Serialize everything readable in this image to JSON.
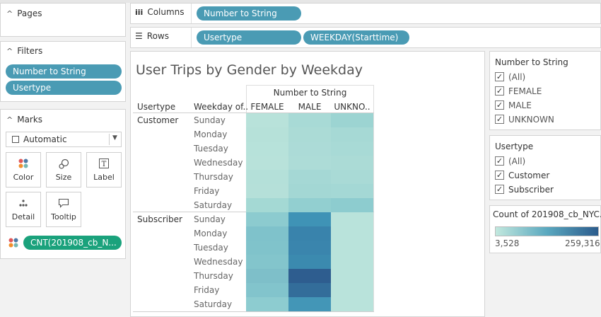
{
  "left": {
    "pages_title": "Pages",
    "filters_title": "Filters",
    "filters": [
      "Number to String",
      "Usertype"
    ],
    "marks_title": "Marks",
    "mark_type": "Automatic",
    "buttons": {
      "color": "Color",
      "size": "Size",
      "label": "Label",
      "detail": "Detail",
      "tooltip": "Tooltip"
    },
    "cnt_pill": "CNT(201908_cb_N..."
  },
  "shelves": {
    "columns_label": "Columns",
    "columns_pills": [
      "Number to String"
    ],
    "rows_label": "Rows",
    "rows_pills": [
      "Usertype",
      "WEEKDAY(Starttime)"
    ]
  },
  "viz": {
    "title": "User Trips by Gender by Weekday",
    "header_group": "Number to String",
    "row_header_1": "Usertype",
    "row_header_2": "Weekday of..",
    "columns": [
      "FEMALE",
      "MALE",
      "UNKNO.."
    ],
    "groups": [
      {
        "name": "Customer",
        "days": [
          "Sunday",
          "Monday",
          "Tuesday",
          "Wednesday",
          "Thursday",
          "Friday",
          "Saturday"
        ]
      },
      {
        "name": "Subscriber",
        "days": [
          "Sunday",
          "Monday",
          "Tuesday",
          "Wednesday",
          "Thursday",
          "Friday",
          "Saturday"
        ]
      }
    ],
    "colors": {
      "customer": [
        [
          "#b8e2da",
          "#a8dad6",
          "#9cd4d2"
        ],
        [
          "#b6e1d9",
          "#abdbd6",
          "#a6d9d5"
        ],
        [
          "#b7e2da",
          "#acdbd7",
          "#a8dad6"
        ],
        [
          "#b8e2da",
          "#addcd7",
          "#abdbd6"
        ],
        [
          "#b4e0d9",
          "#a5d8d5",
          "#a9dad6"
        ],
        [
          "#b5e0d9",
          "#a3d7d4",
          "#a4d8d5"
        ],
        [
          "#a4d9d4",
          "#92cfd0",
          "#8dcccf"
        ]
      ],
      "subscriber": [
        [
          "#8ccbcf",
          "#3f93b6",
          "#b9e3db"
        ],
        [
          "#7fc2cb",
          "#3983ac",
          "#b9e3db"
        ],
        [
          "#80c3cb",
          "#3a85ad",
          "#b9e3db"
        ],
        [
          "#83c5cc",
          "#3b8aaf",
          "#b9e3db"
        ],
        [
          "#7ebfc9",
          "#2e5d8f",
          "#b9e3db"
        ],
        [
          "#82c4cc",
          "#336d9a",
          "#b9e3db"
        ],
        [
          "#8dccd0",
          "#4396b7",
          "#b9e3db"
        ]
      ]
    }
  },
  "filter_cards": {
    "gender_title": "Number to String",
    "gender_items": [
      "(All)",
      "FEMALE",
      "MALE",
      "UNKNOWN"
    ],
    "usertype_title": "Usertype",
    "usertype_items": [
      "(All)",
      "Customer",
      "Subscriber"
    ]
  },
  "legend": {
    "title": "Count of 201908_cb_NYC...",
    "min": "3,528",
    "max": "259,316",
    "color_low": "#c2e8de",
    "color_high": "#2b5b8c"
  }
}
